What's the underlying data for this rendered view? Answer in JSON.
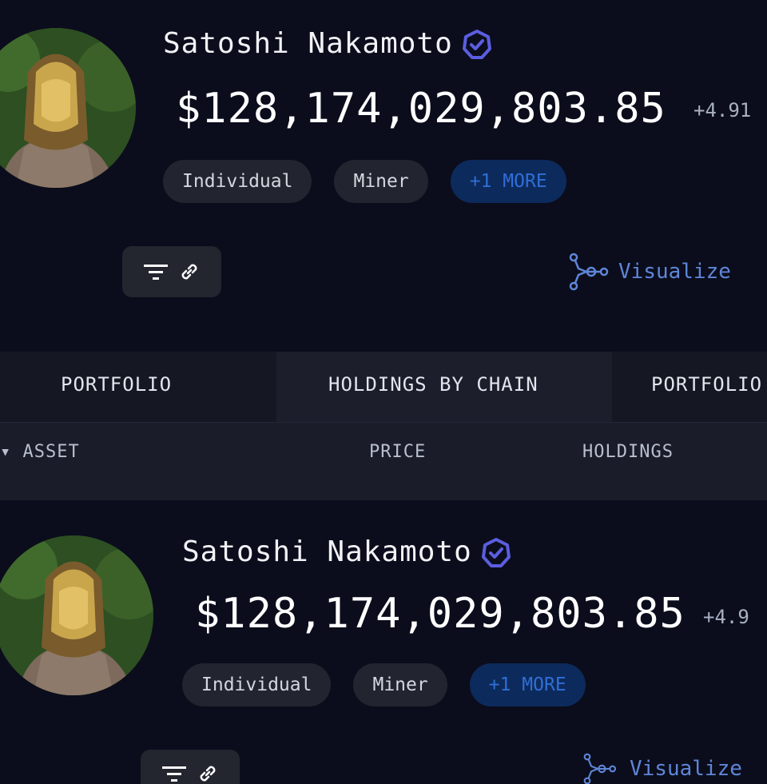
{
  "profiles": [
    {
      "name": "Satoshi Nakamoto",
      "value": "$128,174,029,803.85",
      "change": "+4.91",
      "tags": [
        "Individual",
        "Miner",
        "+1 MORE"
      ],
      "visualize_label": "Visualize"
    },
    {
      "name": "Satoshi Nakamoto",
      "value": "$128,174,029,803.85",
      "change": "+4.9",
      "tags": [
        "Individual",
        "Miner",
        "+1 MORE"
      ],
      "visualize_label": "Visualize"
    }
  ],
  "tabs": [
    "PORTFOLIO",
    "HOLDINGS BY CHAIN",
    "PORTFOLIO"
  ],
  "table_headers": [
    "ASSET",
    "PRICE",
    "HOLDINGS"
  ],
  "icons": {
    "verified": "verified-badge-icon",
    "filter": "filter-icon",
    "link": "link-icon",
    "visualize": "graph-nodes-icon"
  },
  "colors": {
    "background": "#0b0d1c",
    "accent": "#2f6ed6",
    "verified": "#5b5ee0",
    "visualize": "#5f86d8"
  }
}
